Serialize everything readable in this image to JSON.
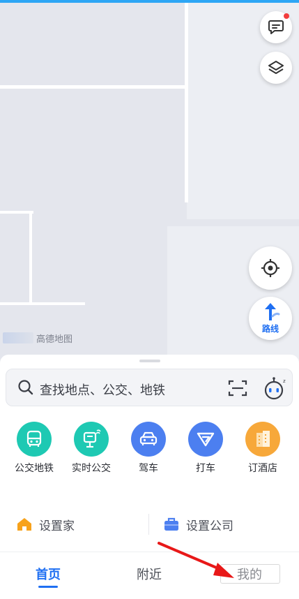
{
  "map": {
    "watermark": "高德地图"
  },
  "controls": {
    "route_label": "路线"
  },
  "search": {
    "placeholder": "查找地点、公交、地铁"
  },
  "quick_actions": [
    {
      "label": "公交地铁",
      "icon": "bus-icon",
      "color": "#1ec9b3"
    },
    {
      "label": "实时公交",
      "icon": "bus-stop-icon",
      "color": "#1ec9b3"
    },
    {
      "label": "驾车",
      "icon": "car-icon",
      "color": "#4c7ff0"
    },
    {
      "label": "打车",
      "icon": "taxi-icon",
      "color": "#4c7ff0"
    },
    {
      "label": "订酒店",
      "icon": "hotel-icon",
      "color": "#f7a83a"
    }
  ],
  "places": {
    "home": "设置家",
    "company": "设置公司"
  },
  "tabs": {
    "home": "首页",
    "nearby": "附近",
    "mine": "我的"
  },
  "colors": {
    "accent": "#1f6ff2",
    "notification_dot": "#f23d3d"
  }
}
